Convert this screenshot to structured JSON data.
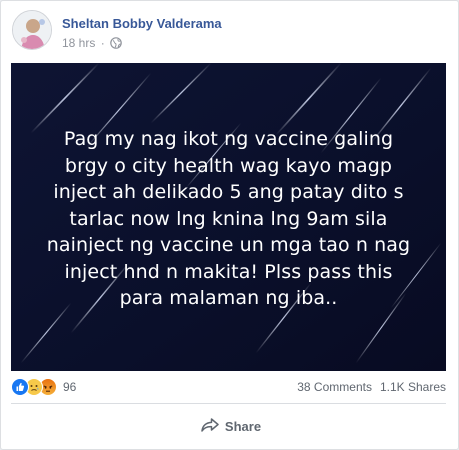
{
  "post": {
    "author": "Sheltan Bobby Valderama",
    "time": "18 hrs",
    "separator": "·",
    "privacy_icon": "globe-icon",
    "image_text": "Pag my nag ikot ng vaccine galing\nbrgy o city health wag kayo magp\ninject ah delikado 5 ang patay dito s\ntarlac now lng knina lng 9am sila\nnainject ng vaccine un mga tao n nag\ninject hnd n makita! Plss pass this\npara malaman ng iba..",
    "image_background": "#0b0f2c"
  },
  "stats": {
    "reaction_icons": [
      "like-icon",
      "sad-icon",
      "angry-icon"
    ],
    "reaction_count": "96",
    "comments": "38 Comments",
    "shares": "1.1K Shares"
  },
  "actions": {
    "share_label": "Share",
    "share_icon": "share-arrow-icon"
  },
  "colors": {
    "author_link": "#385898",
    "meta_text": "#90949c",
    "action_text": "#606770",
    "like_blue": "#1877f2"
  }
}
